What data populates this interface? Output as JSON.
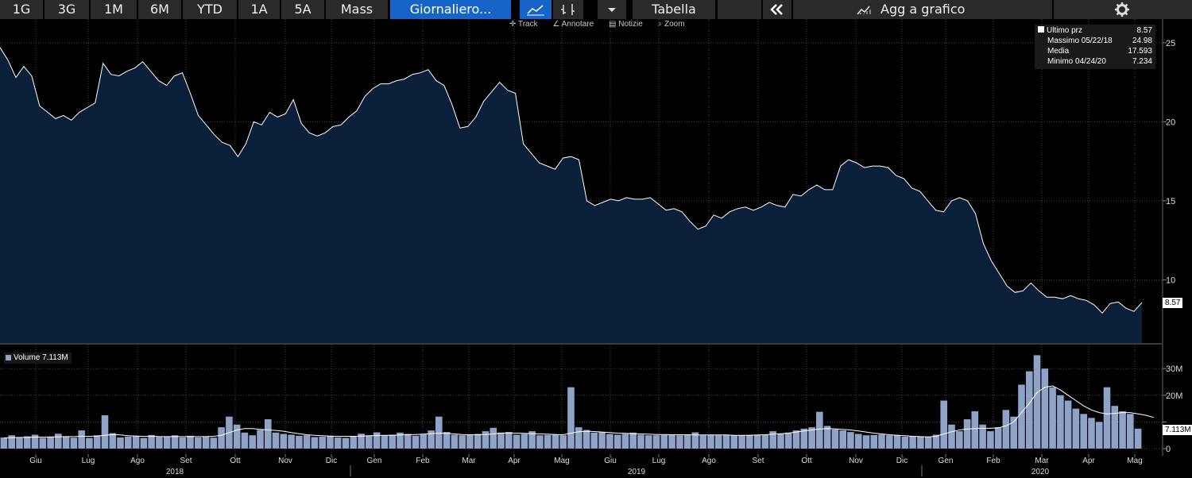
{
  "toolbar": {
    "periods": [
      "1G",
      "3G",
      "1M",
      "6M",
      "YTD",
      "1A",
      "5A",
      "Mass"
    ],
    "frequency": "Giornaliero...",
    "table_label": "Tabella",
    "add_chart_label": "Agg a grafico"
  },
  "subtoolbar": {
    "track": "Track",
    "annotate": "Annotare",
    "news": "Notizie",
    "zoom": "Zoom"
  },
  "legend": {
    "last_label": "Ultimo prz",
    "last_value": "8.57",
    "max_label": "Massimo 05/22/18",
    "max_value": "24.98",
    "avg_label": "Media",
    "avg_value": "17.593",
    "min_label": "Minimo 04/24/20",
    "min_value": "7.234"
  },
  "volume_legend": "Volume 7.113M",
  "last_price_tag": "8.57",
  "last_volume_tag": "7.113M",
  "colors": {
    "accent": "#1764c8",
    "area_fill": "#0a2039",
    "line": "#ffffff",
    "volume_bar": "#8fa3c8"
  },
  "chart_data": [
    {
      "type": "area",
      "title": "",
      "xlabel": "",
      "ylabel": "",
      "ylim": [
        6.0,
        26.5
      ],
      "yticks": [
        10,
        15,
        20,
        25
      ],
      "x_month_ticks": [
        "Giu",
        "Lug",
        "Ago",
        "Set",
        "Ott",
        "Nov",
        "Dic",
        "Gen",
        "Feb",
        "Mar",
        "Apr",
        "Mag",
        "Giu",
        "Lug",
        "Ago",
        "Set",
        "Ott",
        "Nov",
        "Dic",
        "Gen",
        "Feb",
        "Mar",
        "Apr",
        "Mag"
      ],
      "x_year_ticks": [
        "2018",
        "2019",
        "2020"
      ],
      "series": [
        {
          "values": [
            24.7,
            23.9,
            22.8,
            23.5,
            22.9,
            21.0,
            20.6,
            20.2,
            20.4,
            20.1,
            20.6,
            20.9,
            21.2,
            23.7,
            23.0,
            22.9,
            23.2,
            23.4,
            23.8,
            23.2,
            22.6,
            22.3,
            22.9,
            23.1,
            21.8,
            20.4,
            19.8,
            19.2,
            18.7,
            18.5,
            17.8,
            18.6,
            20.0,
            19.8,
            20.6,
            20.3,
            20.5,
            21.4,
            19.9,
            19.3,
            19.1,
            19.3,
            19.7,
            19.8,
            20.3,
            20.7,
            21.6,
            22.1,
            22.4,
            22.4,
            22.6,
            22.7,
            23.0,
            23.1,
            23.3,
            22.6,
            22.3,
            21.1,
            19.6,
            19.7,
            20.3,
            21.3,
            21.9,
            22.5,
            22.0,
            21.8,
            18.6,
            18.0,
            17.4,
            17.2,
            17.0,
            17.7,
            17.8,
            17.6,
            15.0,
            14.7,
            14.9,
            15.1,
            15.0,
            15.2,
            15.1,
            15.1,
            15.2,
            14.8,
            14.4,
            14.5,
            14.3,
            13.7,
            13.2,
            13.4,
            14.1,
            13.9,
            14.3,
            14.5,
            14.6,
            14.4,
            14.6,
            14.9,
            14.7,
            14.6,
            15.4,
            15.3,
            15.7,
            16.0,
            15.7,
            15.7,
            17.2,
            17.6,
            17.4,
            17.1,
            17.2,
            17.2,
            17.1,
            16.6,
            16.4,
            15.8,
            15.6,
            15.0,
            14.4,
            14.3,
            15.0,
            15.2,
            15.0,
            14.2,
            12.3,
            11.2,
            10.4,
            9.6,
            9.2,
            9.3,
            9.8,
            9.3,
            8.9,
            8.9,
            8.8,
            9.0,
            8.8,
            8.7,
            8.4,
            7.9,
            8.5,
            8.6,
            8.2,
            8.0,
            8.57
          ]
        }
      ]
    },
    {
      "type": "bar",
      "title": "",
      "series_label": "Volume",
      "ylim": [
        -1.5,
        39.0
      ],
      "yticks": [
        0,
        10,
        20,
        30
      ],
      "ytick_labels": [
        "0",
        "",
        "20M",
        "30M"
      ],
      "series": [
        {
          "values": [
            4.2,
            5.0,
            4.1,
            4.6,
            5.2,
            4.0,
            4.3,
            5.6,
            4.5,
            4.1,
            6.8,
            4.0,
            5.0,
            12.5,
            5.8,
            4.2,
            4.5,
            4.8,
            4.0,
            5.1,
            4.3,
            4.4,
            5.0,
            4.2,
            4.8,
            4.2,
            4.4,
            4.1,
            8.0,
            12.0,
            9.0,
            6.0,
            5.0,
            7.0,
            11.0,
            6.0,
            5.5,
            5.2,
            4.8,
            5.0,
            4.3,
            4.5,
            4.6,
            4.2,
            4.0,
            4.5,
            5.6,
            4.8,
            6.1,
            5.0,
            5.2,
            6.0,
            5.5,
            4.8,
            5.3,
            6.8,
            12.0,
            6.2,
            5.2,
            5.0,
            5.1,
            5.5,
            6.5,
            7.8,
            6.0,
            6.2,
            5.2,
            5.5,
            6.5,
            5.0,
            5.1,
            5.2,
            5.0,
            23.0,
            8.0,
            7.0,
            6.0,
            6.2,
            5.5,
            5.2,
            5.5,
            6.0,
            5.2,
            5.0,
            5.0,
            5.1,
            5.1,
            5.0,
            5.3,
            6.1,
            5.0,
            5.1,
            5.0,
            5.2,
            5.0,
            5.0,
            5.1,
            5.2,
            5.1,
            6.5,
            5.5,
            6.0,
            6.8,
            7.5,
            8.0,
            13.8,
            8.5,
            7.2,
            6.8,
            6.2,
            5.5,
            5.0,
            5.1,
            5.3,
            5.0,
            5.1,
            4.5,
            4.6,
            4.5,
            4.3,
            5.2,
            18.0,
            9.0,
            6.5,
            11.0,
            14.0,
            9.0,
            6.5,
            8.0,
            14.5,
            12.0,
            24.0,
            29.0,
            35.0,
            30.0,
            23.0,
            20.0,
            18.0,
            15.0,
            13.0,
            11.5,
            10.0,
            23.0,
            16.0,
            14.0,
            13.0,
            7.5
          ]
        },
        {
          "name": "",
          "values": [
            4.0,
            4.1,
            4.2,
            4.2,
            4.3,
            4.3,
            4.4,
            4.4,
            4.5,
            4.5,
            4.6,
            4.6,
            4.7,
            5.0,
            5.3,
            5.1,
            4.8,
            4.7,
            4.6,
            4.6,
            4.5,
            4.5,
            4.5,
            4.5,
            4.5,
            4.5,
            4.5,
            4.6,
            5.0,
            6.0,
            7.0,
            7.5,
            7.5,
            7.2,
            7.0,
            6.8,
            6.5,
            6.0,
            5.6,
            5.2,
            5.0,
            4.8,
            4.7,
            4.6,
            4.6,
            4.6,
            4.7,
            4.8,
            4.9,
            5.0,
            5.0,
            5.1,
            5.2,
            5.3,
            5.4,
            5.6,
            5.8,
            5.7,
            5.5,
            5.3,
            5.2,
            5.2,
            5.3,
            5.5,
            5.8,
            5.9,
            5.8,
            5.7,
            5.6,
            5.5,
            5.4,
            5.3,
            5.2,
            5.8,
            6.3,
            6.5,
            6.4,
            6.2,
            6.0,
            5.8,
            5.7,
            5.6,
            5.5,
            5.4,
            5.3,
            5.3,
            5.2,
            5.2,
            5.2,
            5.1,
            5.1,
            5.1,
            5.1,
            5.1,
            5.0,
            5.0,
            5.0,
            5.1,
            5.2,
            5.4,
            5.6,
            5.8,
            6.2,
            6.6,
            7.0,
            7.3,
            7.5,
            7.4,
            7.2,
            7.0,
            6.6,
            6.2,
            5.8,
            5.5,
            5.2,
            5.0,
            4.8,
            4.6,
            4.5,
            4.4,
            4.6,
            5.5,
            6.3,
            7.0,
            7.3,
            7.5,
            7.6,
            7.6,
            7.8,
            8.5,
            10.0,
            13.5,
            17.0,
            21.0,
            23.0,
            23.5,
            22.0,
            20.0,
            18.0,
            16.0,
            14.5,
            13.5,
            13.0,
            13.2,
            13.5,
            13.5,
            13.0,
            12.5,
            11.7
          ]
        }
      ]
    }
  ]
}
